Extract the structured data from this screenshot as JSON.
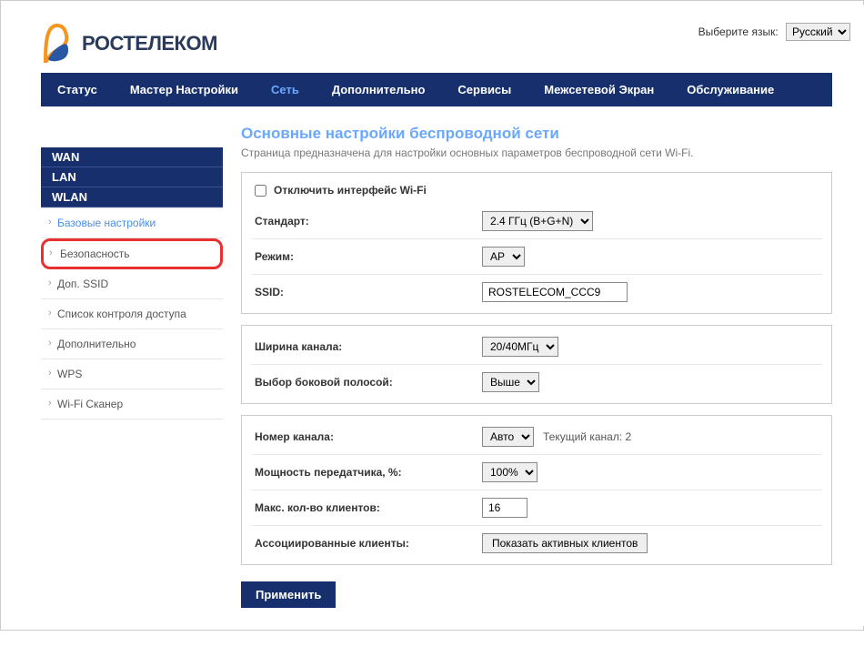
{
  "header": {
    "brand": "РОСТЕЛЕКОМ",
    "lang_label": "Выберите язык:",
    "lang_value": "Русский"
  },
  "nav": {
    "items": [
      "Статус",
      "Мастер Настройки",
      "Сеть",
      "Дополнительно",
      "Сервисы",
      "Межсетевой Экран",
      "Обслуживание"
    ],
    "active_index": 2
  },
  "sidebar": {
    "sections": [
      "WAN",
      "LAN",
      "WLAN"
    ],
    "items": [
      {
        "label": "Базовые настройки",
        "active": true
      },
      {
        "label": "Безопасность",
        "highlight": true
      },
      {
        "label": "Доп. SSID"
      },
      {
        "label": "Список контроля доступа"
      },
      {
        "label": "Дополнительно"
      },
      {
        "label": "WPS"
      },
      {
        "label": "Wi-Fi Сканер"
      }
    ]
  },
  "page": {
    "title": "Основные настройки беспроводной сети",
    "desc": "Страница предназначена для настройки основных параметров беспроводной сети Wi-Fi."
  },
  "form": {
    "disable_label": "Отключить интерфейс Wi-Fi",
    "standard": {
      "label": "Стандарт:",
      "value": "2.4 ГГц (B+G+N)"
    },
    "mode": {
      "label": "Режим:",
      "value": "AP"
    },
    "ssid": {
      "label": "SSID:",
      "value": "ROSTELECOM_CCC9"
    },
    "ch_width": {
      "label": "Ширина канала:",
      "value": "20/40МГц"
    },
    "sideband": {
      "label": "Выбор боковой полосой:",
      "value": "Выше"
    },
    "ch_num": {
      "label": "Номер канала:",
      "value": "Авто",
      "hint": "Текущий канал: 2"
    },
    "tx_power": {
      "label": "Мощность передатчика, %:",
      "value": "100%"
    },
    "max_clients": {
      "label": "Макс. кол-во клиентов:",
      "value": "16"
    },
    "assoc": {
      "label": "Ассоциированные клиенты:",
      "button": "Показать активных клиентов"
    },
    "apply": "Применить"
  }
}
